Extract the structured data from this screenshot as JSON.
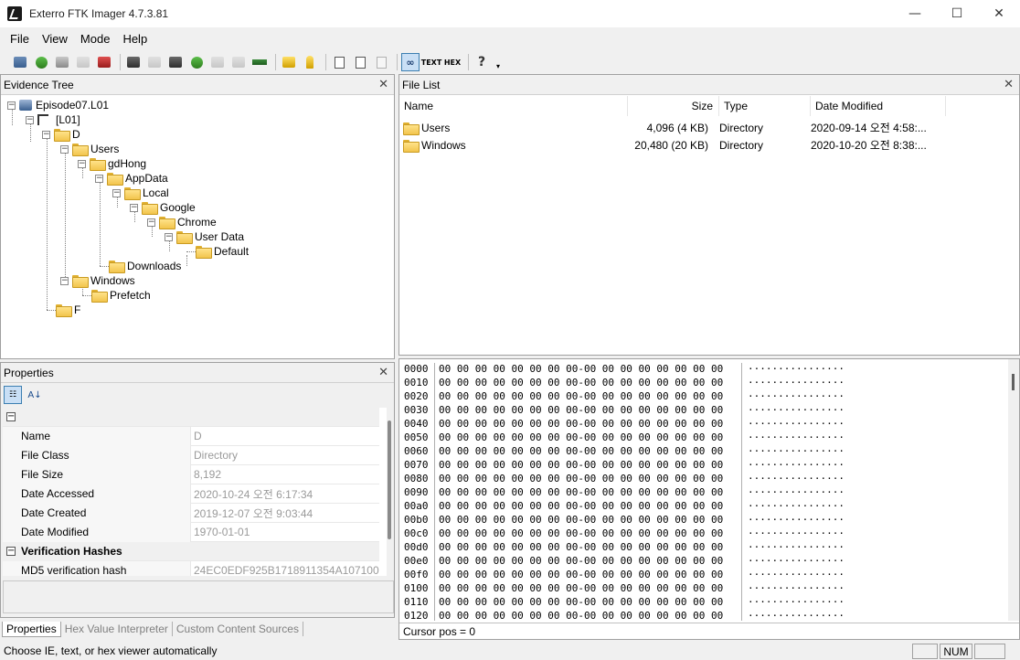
{
  "app": {
    "title": "Exterro FTK Imager 4.7.3.81"
  },
  "window_controls": {
    "minimize": "—",
    "maximize": "☐",
    "close": "✕"
  },
  "menu": [
    "File",
    "View",
    "Mode",
    "Help"
  ],
  "toolbar": {
    "text_label": "TEXT",
    "hex_label": "HEX",
    "help_glyph": "?",
    "overflow_glyph": "▾"
  },
  "evidence_tree": {
    "header": "Evidence Tree",
    "close": "✕",
    "nodes": [
      {
        "label": "Episode07.L01"
      },
      {
        "label": "[L01]"
      },
      {
        "label": "D"
      },
      {
        "label": "Users"
      },
      {
        "label": "gdHong"
      },
      {
        "label": "AppData"
      },
      {
        "label": "Local"
      },
      {
        "label": "Google"
      },
      {
        "label": "Chrome"
      },
      {
        "label": "User Data"
      },
      {
        "label": "Default"
      },
      {
        "label": "Downloads"
      },
      {
        "label": "Windows"
      },
      {
        "label": "Prefetch"
      },
      {
        "label": "F"
      }
    ]
  },
  "properties": {
    "header": "Properties",
    "close": "✕",
    "rows": [
      {
        "key": "Name",
        "value": "D"
      },
      {
        "key": "File Class",
        "value": "Directory"
      },
      {
        "key": "File Size",
        "value": "8,192"
      },
      {
        "key": "Date Accessed",
        "value": "2020-10-24 오전 6:17:34"
      },
      {
        "key": "Date Created",
        "value": "2019-12-07 오전 9:03:44"
      },
      {
        "key": "Date Modified",
        "value": "1970-01-01"
      }
    ],
    "group2": "Verification Hashes",
    "hash_row": {
      "key": "MD5 verification hash",
      "value": "24EC0EDF925B1718911354A107100"
    },
    "tabs": [
      "Properties",
      "Hex Value Interpreter",
      "Custom Content Sources"
    ]
  },
  "file_list": {
    "header": "File List",
    "close": "✕",
    "columns": [
      "Name",
      "Size",
      "Type",
      "Date Modified"
    ],
    "rows": [
      {
        "name": "Users",
        "size": "4,096 (4 KB)",
        "type": "Directory",
        "modified": "2020-09-14 오전 4:58:..."
      },
      {
        "name": "Windows",
        "size": "20,480 (20 KB)",
        "type": "Directory",
        "modified": "2020-10-20 오전 8:38:..."
      }
    ]
  },
  "hex_view": {
    "rows": [
      {
        "offset": "0000",
        "bytes": "00 00 00 00 00 00 00 00-00 00 00 00 00 00 00 00",
        "ascii": "················"
      },
      {
        "offset": "0010",
        "bytes": "00 00 00 00 00 00 00 00-00 00 00 00 00 00 00 00",
        "ascii": "················"
      },
      {
        "offset": "0020",
        "bytes": "00 00 00 00 00 00 00 00-00 00 00 00 00 00 00 00",
        "ascii": "················"
      },
      {
        "offset": "0030",
        "bytes": "00 00 00 00 00 00 00 00-00 00 00 00 00 00 00 00",
        "ascii": "················"
      },
      {
        "offset": "0040",
        "bytes": "00 00 00 00 00 00 00 00-00 00 00 00 00 00 00 00",
        "ascii": "················"
      },
      {
        "offset": "0050",
        "bytes": "00 00 00 00 00 00 00 00-00 00 00 00 00 00 00 00",
        "ascii": "················"
      },
      {
        "offset": "0060",
        "bytes": "00 00 00 00 00 00 00 00-00 00 00 00 00 00 00 00",
        "ascii": "················"
      },
      {
        "offset": "0070",
        "bytes": "00 00 00 00 00 00 00 00-00 00 00 00 00 00 00 00",
        "ascii": "················"
      },
      {
        "offset": "0080",
        "bytes": "00 00 00 00 00 00 00 00-00 00 00 00 00 00 00 00",
        "ascii": "················"
      },
      {
        "offset": "0090",
        "bytes": "00 00 00 00 00 00 00 00-00 00 00 00 00 00 00 00",
        "ascii": "················"
      },
      {
        "offset": "00a0",
        "bytes": "00 00 00 00 00 00 00 00-00 00 00 00 00 00 00 00",
        "ascii": "················"
      },
      {
        "offset": "00b0",
        "bytes": "00 00 00 00 00 00 00 00-00 00 00 00 00 00 00 00",
        "ascii": "················"
      },
      {
        "offset": "00c0",
        "bytes": "00 00 00 00 00 00 00 00-00 00 00 00 00 00 00 00",
        "ascii": "················"
      },
      {
        "offset": "00d0",
        "bytes": "00 00 00 00 00 00 00 00-00 00 00 00 00 00 00 00",
        "ascii": "················"
      },
      {
        "offset": "00e0",
        "bytes": "00 00 00 00 00 00 00 00-00 00 00 00 00 00 00 00",
        "ascii": "················"
      },
      {
        "offset": "00f0",
        "bytes": "00 00 00 00 00 00 00 00-00 00 00 00 00 00 00 00",
        "ascii": "················"
      },
      {
        "offset": "0100",
        "bytes": "00 00 00 00 00 00 00 00-00 00 00 00 00 00 00 00",
        "ascii": "················"
      },
      {
        "offset": "0110",
        "bytes": "00 00 00 00 00 00 00 00-00 00 00 00 00 00 00 00",
        "ascii": "················"
      },
      {
        "offset": "0120",
        "bytes": "00 00 00 00 00 00 00 00-00 00 00 00 00 00 00 00",
        "ascii": "················"
      }
    ],
    "cursor_pos": "Cursor pos = 0"
  },
  "status_bar": {
    "text": "Choose IE, text, or hex viewer automatically",
    "num": "NUM"
  },
  "colors": {
    "accent": "#3c7fb1",
    "selected_bg": "#c9dff5",
    "folder": "#f2c44c"
  }
}
